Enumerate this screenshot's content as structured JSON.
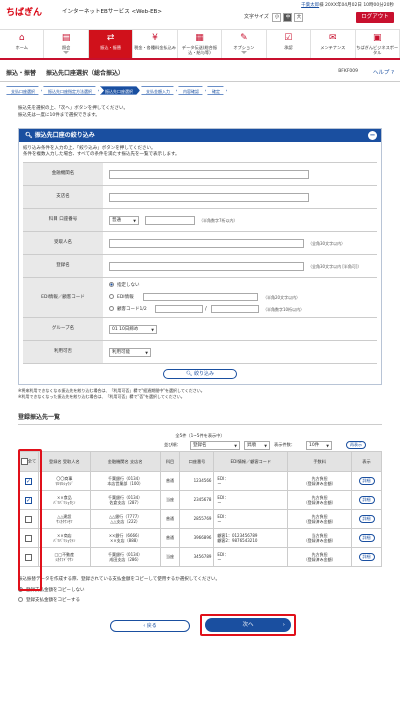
{
  "header": {
    "logo": "ちばぎん",
    "service": "インターネットEBサービス <Web-EB>",
    "user_name": "千葉太郎",
    "user_suffix": "様",
    "last_login": "20XX年04月02日 10時00分20秒",
    "text_size_label": "文字サイズ",
    "size_small": "小",
    "size_mid": "中",
    "size_large": "大",
    "logout": "ログアウト"
  },
  "nav": [
    {
      "label": "ホーム",
      "icon": "home-icon",
      "glyph": "⌂"
    },
    {
      "label": "照会",
      "icon": "document-icon",
      "glyph": "▤"
    },
    {
      "label": "振込・振替",
      "icon": "transfer-icon",
      "glyph": "⇄"
    },
    {
      "label": "税金・各種料金払込み",
      "icon": "tax-icon",
      "glyph": "¥"
    },
    {
      "label": "データ伝送(総合振込・給与等)",
      "icon": "data-icon",
      "glyph": "▦"
    },
    {
      "label": "オプション",
      "icon": "option-icon",
      "glyph": "✎"
    },
    {
      "label": "承認",
      "icon": "approve-icon",
      "glyph": "☑"
    },
    {
      "label": "メンテナンス",
      "icon": "maintenance-icon",
      "glyph": "✉"
    },
    {
      "label": "ちばぎんビジネスポータル",
      "icon": "portal-icon",
      "glyph": "▣"
    }
  ],
  "title": {
    "section": "振込・振替",
    "page": "振込先口座選択（総合振込）",
    "code": "BFKF009",
    "help": "ヘルプ ?"
  },
  "steps": [
    "支払口座選択",
    "振込先口座指定方法選択",
    "振込先口座選択",
    "支払金額入力",
    "内容確認",
    "確定"
  ],
  "instructions": [
    "振込先を選択の上、「次へ」ボタンを押してください。",
    "振込先は一度に10件まで選択できます。"
  ],
  "filter": {
    "title": "振込先口座の絞り込み",
    "desc1": "絞り込み条件を入力の上、「絞り込み」ボタンを押してください。",
    "desc2": "条件を複数入力した場合、すべての条件を満たす振込先を一覧で表示します。",
    "bank_label": "金融機関名",
    "branch_label": "支店名",
    "account_label": "科目 口座番号",
    "account_type": "普通",
    "account_note": "（半角数字7桁以内）",
    "payee_label": "受取人名",
    "payee_note": "（全角30文字以内）",
    "reg_label": "登録名",
    "reg_note": "（全角30文字以内 [半角可]）",
    "edi_label": "EDI情報／顧客コード",
    "edi_none": "指定しない",
    "edi_info": "EDI情報",
    "edi_info_note": "（半角20文字以内）",
    "edi_code": "顧客コード1/2",
    "edi_code_note": "（半角数字10桁以内）",
    "group_label": "グループ名",
    "group_value": "01 10日締め",
    "usage_label": "利用可否",
    "usage_value": "利用可能",
    "submit": "絞り込み"
  },
  "notes": [
    "※将来利用できなくなる振込先を絞り込む場合は、「利用可否」欄で\"経過期間中\"を選択してください。",
    "※利用できなくなった振込先を絞り込む場合は、「利用可否」欄で\"否\"を選択してください。"
  ],
  "list": {
    "title": "登録振込先一覧",
    "count": "全5件（1~5件を表示中）",
    "sort_label": "並び順：",
    "sort_value": "登録名",
    "order_value": "昇順",
    "per_page_label": "表示件数：",
    "per_page_value": "10件",
    "redisplay": "再表示",
    "headers": {
      "all": "全て",
      "name": "登録名 受取人名",
      "bank": "金融機関名 支店名",
      "type": "科目",
      "acct": "口座番号",
      "edi": "EDI情報／顧客コード",
      "fee": "手数料",
      "show": "表示"
    },
    "rows": [
      {
        "name1": "〇〇商事",
        "name2": "ﾏﾙﾏﾙｼｮｳｼﾞ",
        "bank1": "千葉銀行（0134）",
        "bank2": "本店営業部（100）",
        "type": "普通",
        "acct": "1234566",
        "edi1": "EDI：",
        "edi2": "ー",
        "fee1": "先方負担",
        "fee2": "（登録済み金額）",
        "checked": true
      },
      {
        "name1": "××食品",
        "name2": "ﾊﾞﾂﾊﾞﾂｼｮｸﾋﾝ",
        "bank1": "千葉銀行（0134）",
        "bank2": "佐倉支店（287）",
        "type": "当座",
        "acct": "2345678",
        "edi1": "EDI：",
        "edi2": "ー",
        "fee1": "先方負担",
        "fee2": "（登録済み金額）",
        "checked": true
      },
      {
        "name1": "△△建設",
        "name2": "ｻﾝｶｸｹﾝｾﾂ",
        "bank1": "△△銀行（7777）",
        "bank2": "△△支店（222）",
        "type": "普通",
        "acct": "2855769",
        "edi1": "EDI：",
        "edi2": "ー",
        "fee1": "先方負担",
        "fee2": "（登録済み金額）",
        "checked": false
      },
      {
        "name1": "××商店",
        "name2": "ﾊﾞﾂﾊﾞﾂｼｮｳﾃﾝ",
        "bank1": "××銀行（6666）",
        "bank2": "××支店（888）",
        "type": "普通",
        "acct": "3966896",
        "edi1": "顧客1：0123456789",
        "edi2": "顧客2：9876543210",
        "fee1": "当方負担",
        "fee2": "（登録済み金額）",
        "checked": false
      },
      {
        "name1": "□□不動産",
        "name2": "ｼｶｸﾌﾄﾞｳｻﾝ",
        "bank1": "千葉銀行（0134）",
        "bank2": "成田支店（286）",
        "type": "当座",
        "acct": "3456789",
        "edi1": "EDI：",
        "edi2": "ー",
        "fee1": "先方負担",
        "fee2": "（登録済み金額）",
        "checked": false
      }
    ],
    "detail": "詳細"
  },
  "copy": {
    "desc": "振込振替データを作成する際、登録されている支払金額をコピーして使用するか選択してください。",
    "no_copy": "登録支払金額をコピーしない",
    "copy": "登録支払金額をコピーする"
  },
  "buttons": {
    "back": "戻る",
    "next": "次へ"
  },
  "colors": {
    "accent_red": "#c8102e",
    "primary_blue": "#1a4fa0"
  }
}
